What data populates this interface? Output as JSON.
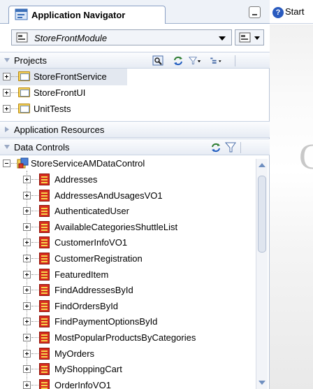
{
  "navigator": {
    "tab_title": "Application Navigator",
    "module": "StoreFrontModule"
  },
  "projects": {
    "header": "Projects",
    "items": [
      "StoreFrontService",
      "StoreFrontUI",
      "UnitTests"
    ]
  },
  "app_resources": {
    "header": "Application Resources"
  },
  "data_controls": {
    "header": "Data Controls",
    "root": "StoreServiceAMDataControl",
    "items": [
      "Addresses",
      "AddressesAndUsagesVO1",
      "AuthenticatedUser",
      "AvailableCategoriesShuttleList",
      "CustomerInfoVO1",
      "CustomerRegistration",
      "FeaturedItem",
      "FindAddressesById",
      "FindOrdersById",
      "FindPaymentOptionsById",
      "MostPopularProductsByCategories",
      "MyOrders",
      "MyShoppingCart",
      "OrderInfoVO1"
    ]
  },
  "start_page": {
    "tab_label": "Start",
    "help_glyph": "?",
    "logo_letter": "C"
  }
}
